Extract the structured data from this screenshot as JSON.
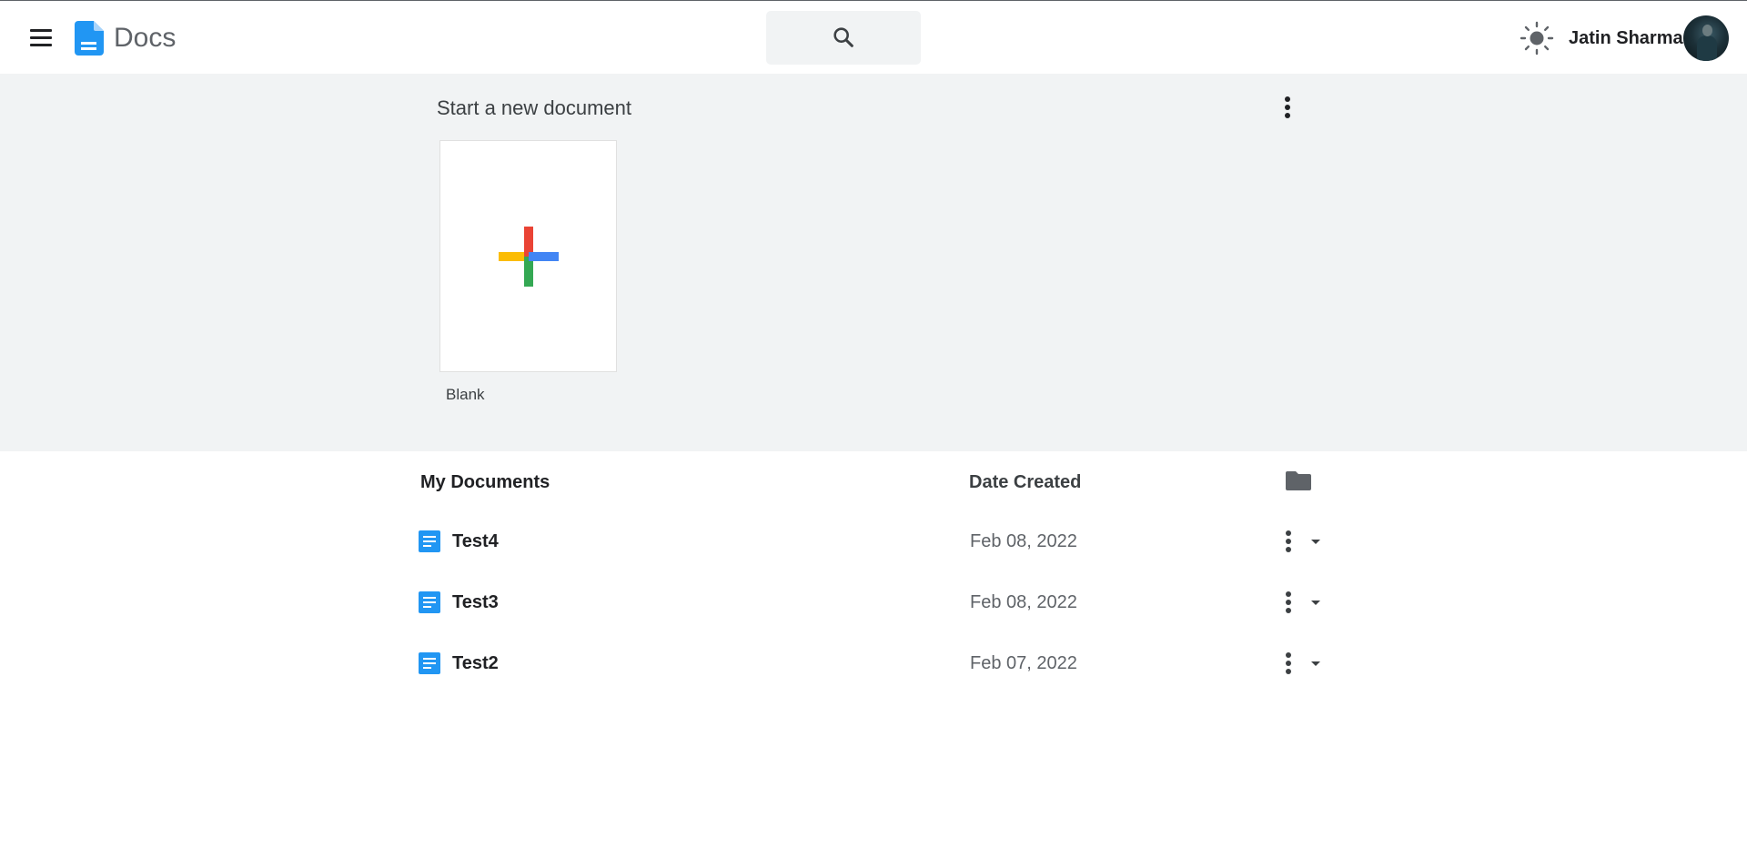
{
  "header": {
    "menu_icon": "hamburger-menu-icon",
    "logo_icon": "docs-logo-icon",
    "app_title": "Docs",
    "search_icon": "search-icon",
    "theme_icon": "sun-icon",
    "user_name": "Jatin Sharma",
    "avatar_icon": "user-avatar"
  },
  "start_section": {
    "title": "Start a new document",
    "more_icon": "more-vert-icon",
    "templates": [
      {
        "label": "Blank",
        "icon": "plus-icon"
      }
    ]
  },
  "documents": {
    "title": "My Documents",
    "date_header": "Date Created",
    "folder_icon": "folder-icon",
    "rows": [
      {
        "name": "Test4",
        "date": "Feb 08, 2022"
      },
      {
        "name": "Test3",
        "date": "Feb 08, 2022"
      },
      {
        "name": "Test2",
        "date": "Feb 07, 2022"
      }
    ]
  },
  "colors": {
    "brand_blue": "#2196f3",
    "section_bg": "#f1f3f4",
    "plus_red": "#ea4335",
    "plus_blue": "#4285f4",
    "plus_yellow": "#fbbc04",
    "plus_green": "#34a853"
  }
}
